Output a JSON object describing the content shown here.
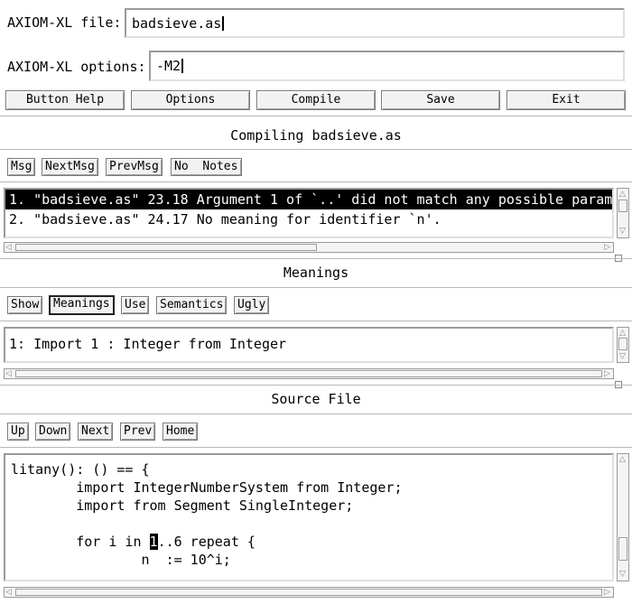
{
  "file": {
    "label": "AXIOM-XL file:",
    "value": "badsieve.as"
  },
  "options": {
    "label": "AXIOM-XL options:",
    "value": "-M2"
  },
  "toolbar": {
    "help": "Button Help",
    "options": "Options",
    "compile": "Compile",
    "save": "Save",
    "exit": "Exit"
  },
  "status": {
    "title": "Compiling badsieve.as"
  },
  "msgbar": {
    "msg": "Msg",
    "next": "NextMsg",
    "prev": "PrevMsg",
    "no": "No",
    "notes": "Notes"
  },
  "messages": [
    "1. \"badsieve.as\" 23.18 Argument 1 of `..' did not match any possible param",
    "2. \"badsieve.as\" 24.17 No meaning for identifier `n'."
  ],
  "meanings": {
    "title": "Meanings",
    "buttons": {
      "show": "Show",
      "meanings": "Meanings",
      "use": "Use",
      "semantics": "Semantics",
      "ugly": "Ugly"
    },
    "items": [
      "1: Import 1 : Integer from Integer"
    ]
  },
  "source": {
    "title": "Source File",
    "buttons": {
      "up": "Up",
      "down": "Down",
      "next": "Next",
      "prev": "Prev",
      "home": "Home"
    },
    "lines": {
      "l1": "litany(): () == {",
      "l2": "        import IntegerNumberSystem from Integer;",
      "l3": "        import from Segment SingleInteger;",
      "l4": "",
      "l5a": "        for i in ",
      "l5h": "1",
      "l5b": "..6 repeat {",
      "l6": "                n  := 10^i;"
    }
  }
}
